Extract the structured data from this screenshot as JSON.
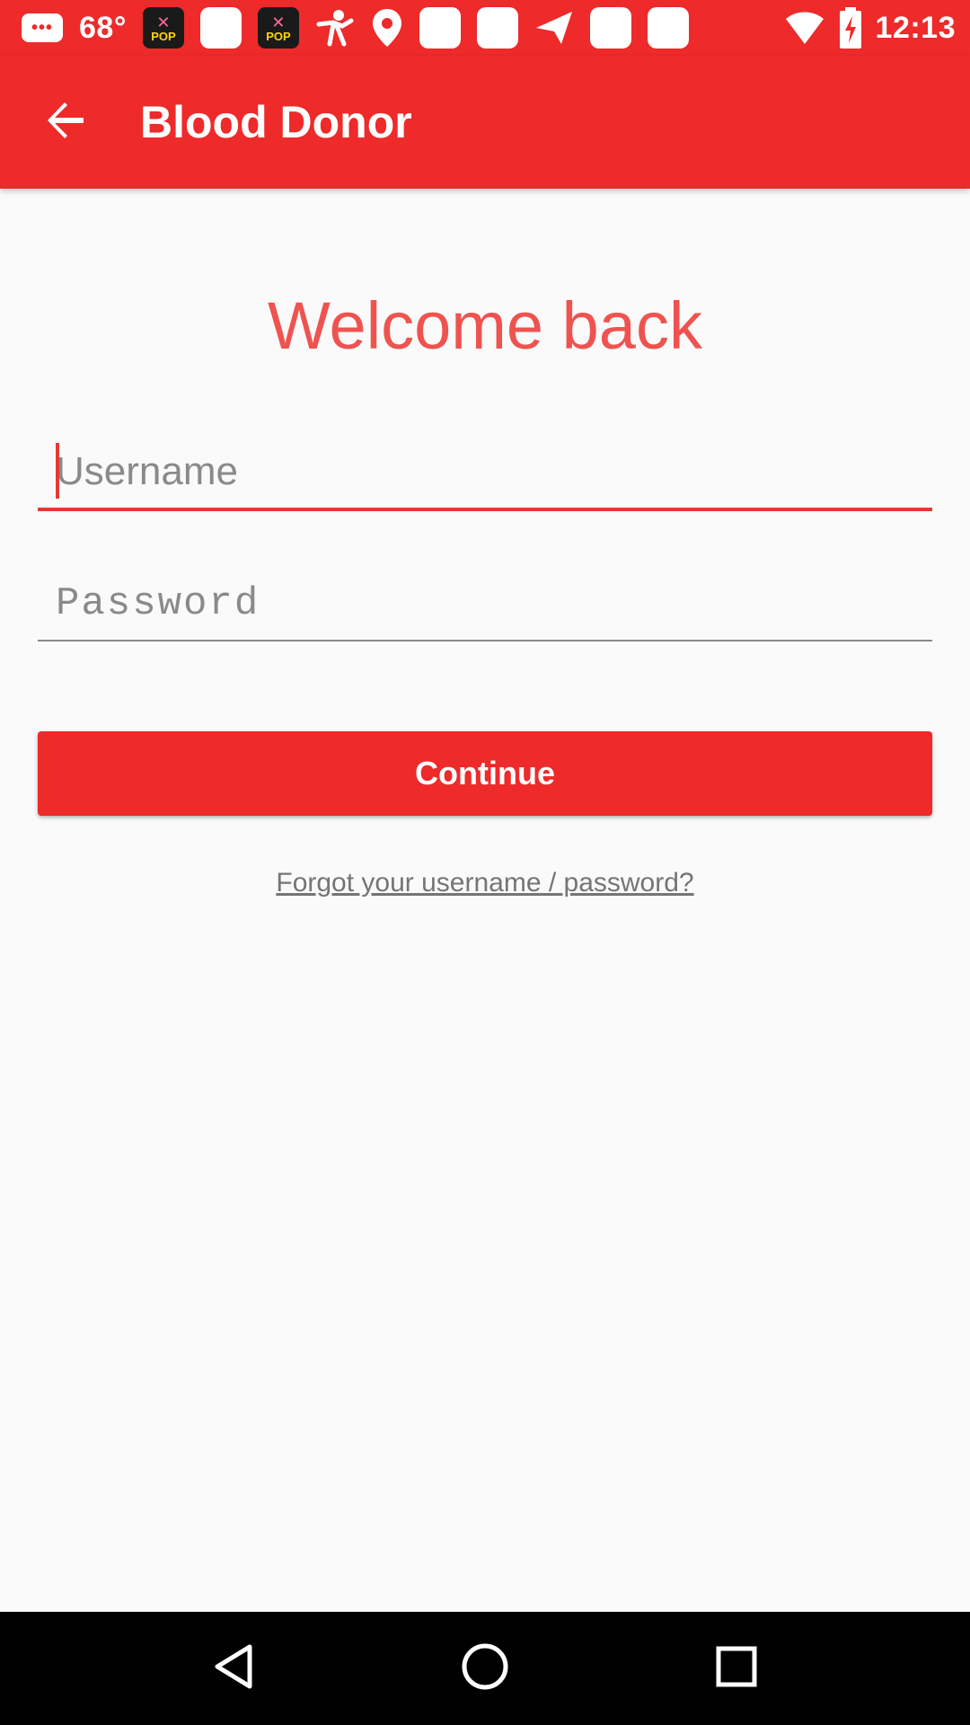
{
  "status_bar": {
    "temperature": "68°",
    "time": "12:13",
    "message_icon_text": "•••",
    "left_icons": [
      "message-icon",
      "pop-app-icon",
      "app-square-icon",
      "pop-app-icon",
      "person-activity-icon",
      "location-pin-icon",
      "app-square-icon",
      "app-square-icon",
      "paper-plane-icon",
      "app-square-icon",
      "app-square-icon"
    ],
    "right_icons": [
      "wifi-icon",
      "battery-charging-icon"
    ],
    "pop_badge_text": "POP"
  },
  "app_bar": {
    "title": "Blood Donor",
    "back_icon": "arrow-back-icon",
    "color": "#ee2a2a"
  },
  "login": {
    "heading": "Welcome back",
    "username_placeholder": "Username",
    "password_placeholder": "Password",
    "continue_label": "Continue",
    "forgot_link": "Forgot your username / password?"
  },
  "nav_bar": {
    "buttons": [
      "back-triangle-icon",
      "home-circle-icon",
      "recents-square-icon"
    ]
  },
  "colors": {
    "brand_red": "#ee2a2a",
    "heading_red": "#ef5350",
    "focus_underline": "#e53935",
    "background": "#fafafa"
  }
}
